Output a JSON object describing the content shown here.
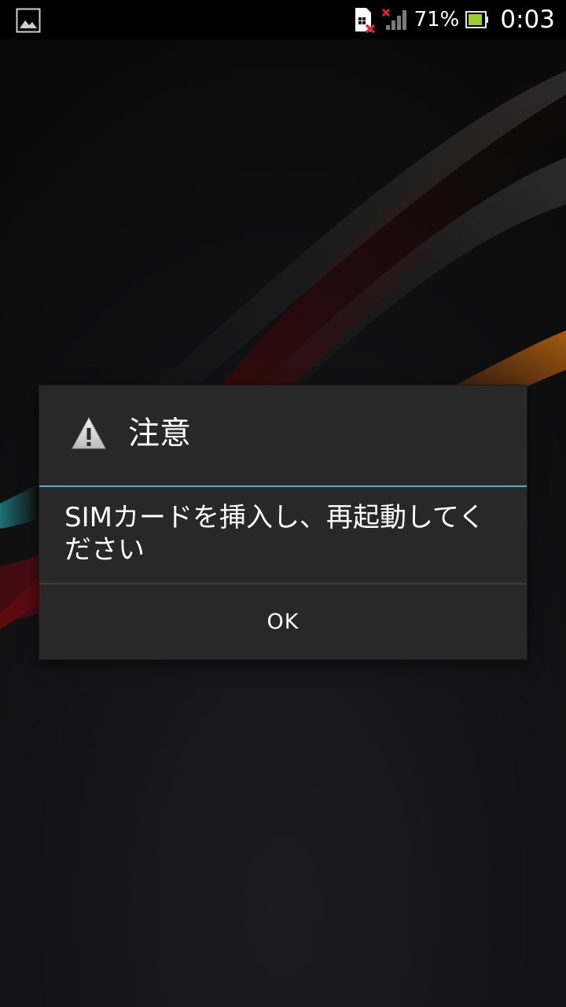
{
  "status_bar": {
    "left_icon": "gallery-notification-icon",
    "sim_icon": "no-sim-icon",
    "signal_icon": "signal-no-service-icon",
    "battery_percent": "71%",
    "battery_icon": "battery-icon",
    "clock": "0:03"
  },
  "dialog": {
    "icon": "warning-icon",
    "title": "注意",
    "message": "SIMカードを挿入し、再起動してください",
    "ok_label": "OK"
  },
  "colors": {
    "accent_divider": "#33b5e5",
    "dialog_background": "#282828",
    "status_bar_background": "#000000",
    "battery_fill": "#9acd32",
    "error_red": "#e0202a"
  }
}
